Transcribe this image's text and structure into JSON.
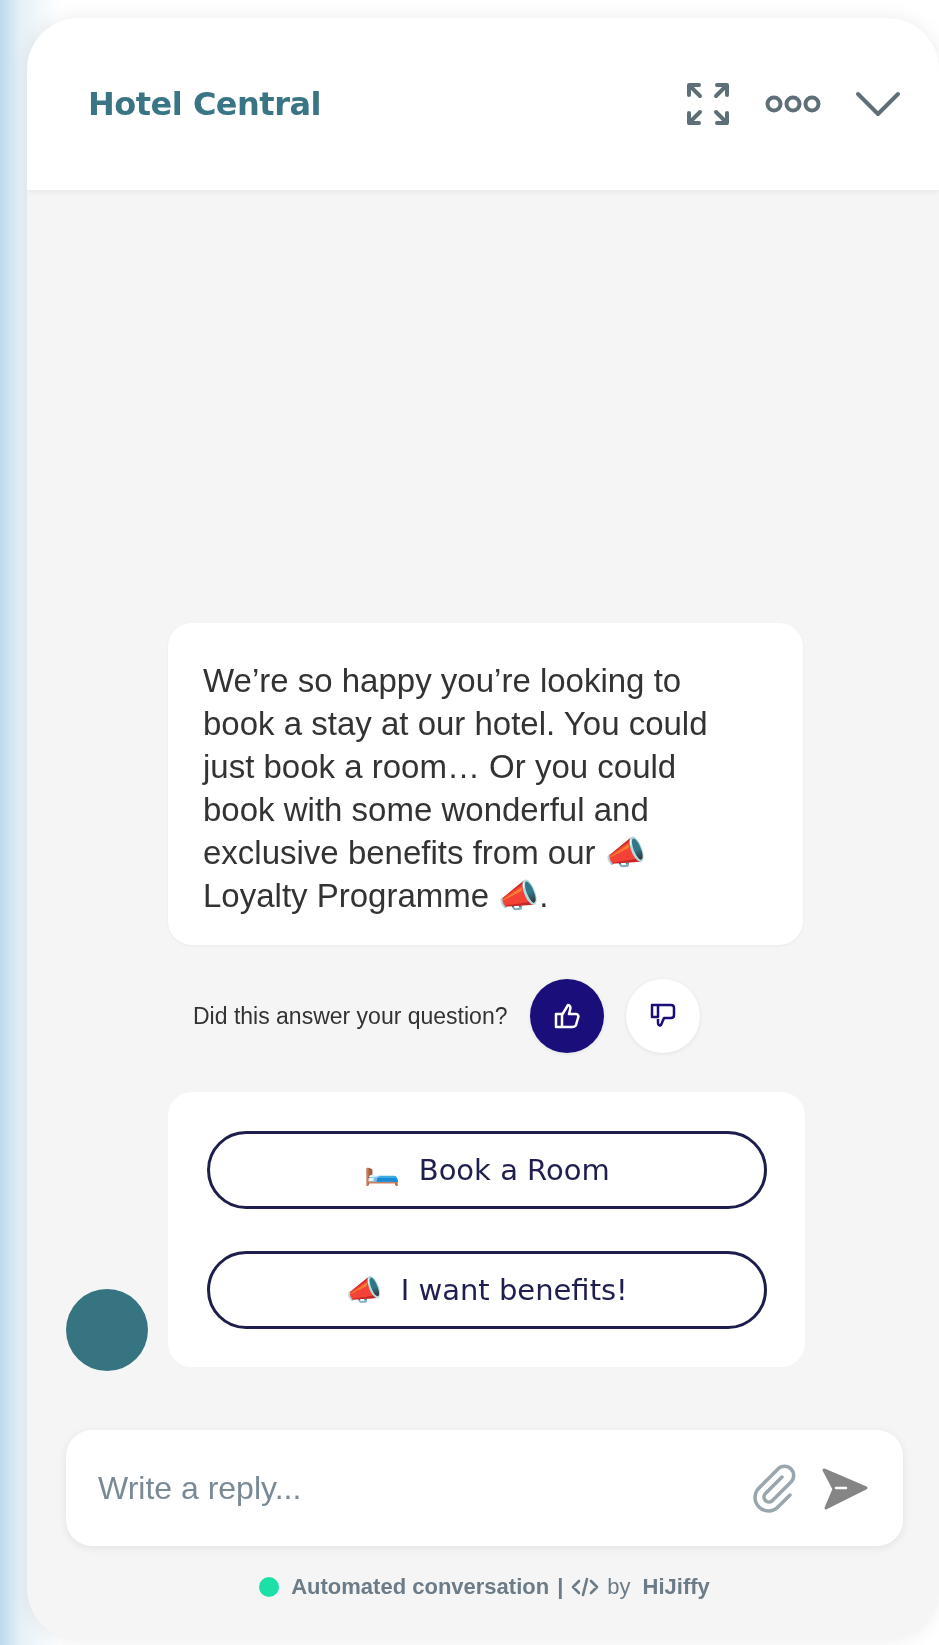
{
  "header": {
    "title": "Hotel Central"
  },
  "message": {
    "text": "We’re so happy you’re looking to book a stay at our hotel. You could just book a room… Or you could book with some wonderful and exclusive benefits from our  📣 Loyalty Programme 📣."
  },
  "feedback": {
    "question": "Did this answer your question?",
    "options": [
      {
        "kind": "up",
        "selected": true
      },
      {
        "kind": "down",
        "selected": false
      }
    ]
  },
  "quick_replies": [
    {
      "emoji": "🛏️",
      "label": "Book a Room"
    },
    {
      "emoji": "📣",
      "label": "I want benefits!"
    }
  ],
  "composer": {
    "placeholder": "Write a reply..."
  },
  "footer": {
    "status": "Automated conversation",
    "separator": "|",
    "by": "by",
    "brand": "HiJiffy"
  }
}
